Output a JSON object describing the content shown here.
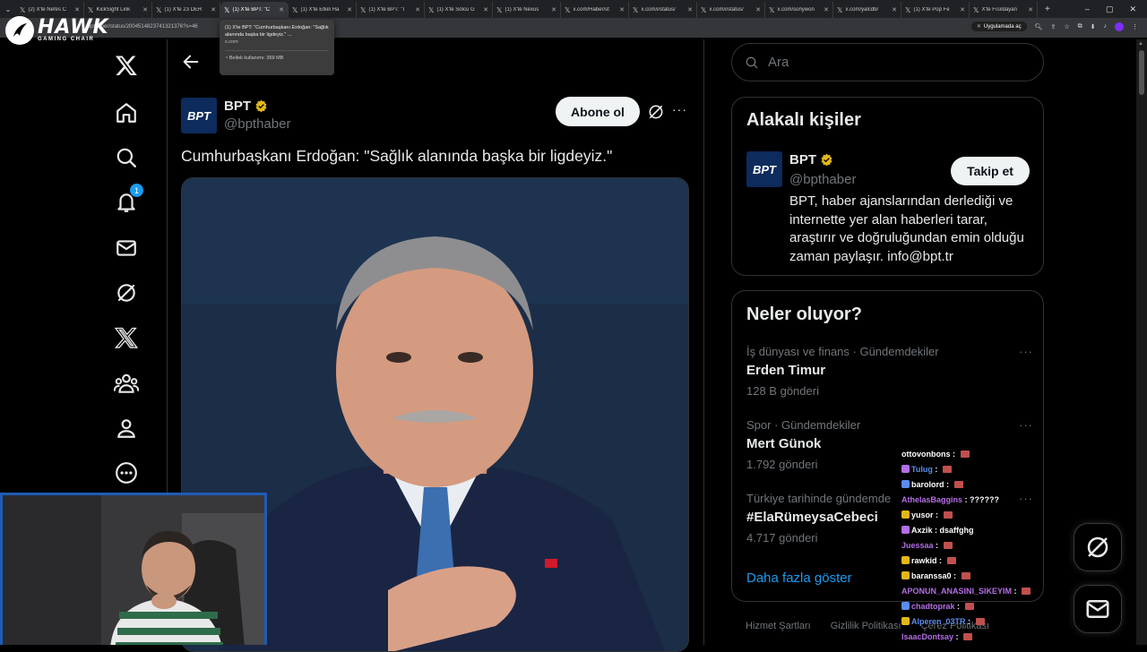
{
  "browser": {
    "tabs": [
      {
        "title": "(2) X'te Nefes C",
        "active": false
      },
      {
        "title": "KickSight Link",
        "active": false
      },
      {
        "title": "(1) X'te 23 DER",
        "active": false
      },
      {
        "title": "(1) X'te BPT: \"C",
        "active": true
      },
      {
        "title": "(1) X'te Etkili Ha",
        "active": false
      },
      {
        "title": "(1) X'te BPT: \"T",
        "active": false
      },
      {
        "title": "(1) X'te Solcu G",
        "active": false
      },
      {
        "title": "(1) X'te Nexus",
        "active": false
      },
      {
        "title": "x.com/Haber/st",
        "active": false
      },
      {
        "title": "x.com/i/status/",
        "active": false
      },
      {
        "title": "x.com/i/status/",
        "active": false
      },
      {
        "title": "x.com/sonywon",
        "active": false
      },
      {
        "title": "x.com/yalcdb/",
        "active": false
      },
      {
        "title": "(1) X'te Pop Fe",
        "active": false
      },
      {
        "title": "X'te Fısıldayan",
        "active": false
      }
    ],
    "url": "/bpthaber/status/2004514823741321376?s=46",
    "app_prompt": "Uygulamada aç",
    "tooltip": {
      "title": "(1) X'te BPT: \"Cumhurbaşkanı Erdoğan: \"Sağlık alanında başka bir ligdeyiz.\" ...",
      "domain": "x.com",
      "memory": "Bellek kullanımı: 369 MB"
    }
  },
  "overlay": {
    "logo_brand": "HAWK",
    "logo_sub": "GAMING CHAIR"
  },
  "nav": {
    "items": [
      "x-logo-icon",
      "home-icon",
      "explore-icon",
      "notifications-icon",
      "messages-icon",
      "grok-icon",
      "premium-x-icon",
      "communities-icon",
      "profile-icon",
      "more-icon"
    ],
    "notification_count": "1"
  },
  "tweet": {
    "author_name": "BPT",
    "author_handle": "@bpthaber",
    "subscribe_label": "Abone ol",
    "text": "Cumhurbaşkanı Erdoğan: \"Sağlık alanında başka bir ligdeyiz.\""
  },
  "search": {
    "placeholder": "Ara"
  },
  "relevant_people": {
    "title": "Alakalı kişiler",
    "name": "BPT",
    "handle": "@bpthaber",
    "follow_label": "Takip et",
    "bio": "BPT, haber ajanslarından derlediği ve internette yer alan haberleri tarar, araştırır ve doğruluğundan emin olduğu zaman paylaşır. info@bpt.tr"
  },
  "trends": {
    "title": "Neler oluyor?",
    "items": [
      {
        "category": "İş dünyası ve finans · Gündemdekiler",
        "name": "Erden Timur",
        "count": "128 B gönderi"
      },
      {
        "category": "Spor · Gündemdekiler",
        "name": "Mert Günok",
        "count": "1.792 gönderi"
      },
      {
        "category": "Türkiye tarihinde gündemde",
        "name": "#ElaRümeysaCebeci",
        "count": "4.717 gönderi"
      }
    ],
    "show_more": "Daha fazla göster"
  },
  "footer": {
    "links": [
      "Hizmet Şartları",
      "Gizlilik Politikası",
      "Çerez Politikası"
    ]
  },
  "chat": {
    "lines": [
      {
        "user": "ottovonbons",
        "color": "#ffffff",
        "msg": ""
      },
      {
        "user": "Tulug",
        "color": "#5b8def",
        "msg": ""
      },
      {
        "user": "barolord",
        "color": "#ffffff",
        "msg": ""
      },
      {
        "user": "AthelasBaggins",
        "color": "#b46ee6",
        "msg": "??????"
      },
      {
        "user": "yusor",
        "color": "#ffffff",
        "msg": ""
      },
      {
        "user": "Axzik",
        "color": "#ffffff",
        "msg": "dsaffghg"
      },
      {
        "user": "Juessaa",
        "color": "#b46ee6",
        "msg": ""
      },
      {
        "user": "rawkid",
        "color": "#ffffff",
        "msg": ""
      },
      {
        "user": "baranssa0",
        "color": "#ffffff",
        "msg": ""
      },
      {
        "user": "APONUN_ANASINI_SIKEYIM",
        "color": "#b46ee6",
        "msg": ""
      },
      {
        "user": "chadtoprak",
        "color": "#b46ee6",
        "msg": ""
      },
      {
        "user": "Alperen_03TR",
        "color": "#5b8def",
        "msg": ""
      },
      {
        "user": "IsaacDontsay",
        "color": "#b46ee6",
        "msg": ""
      }
    ]
  },
  "colors": {
    "accent": "#1d9bf0",
    "border": "#2f3336",
    "muted": "#71767b",
    "verified": "#e2b719",
    "webcam_border": "#1f5bb5"
  }
}
